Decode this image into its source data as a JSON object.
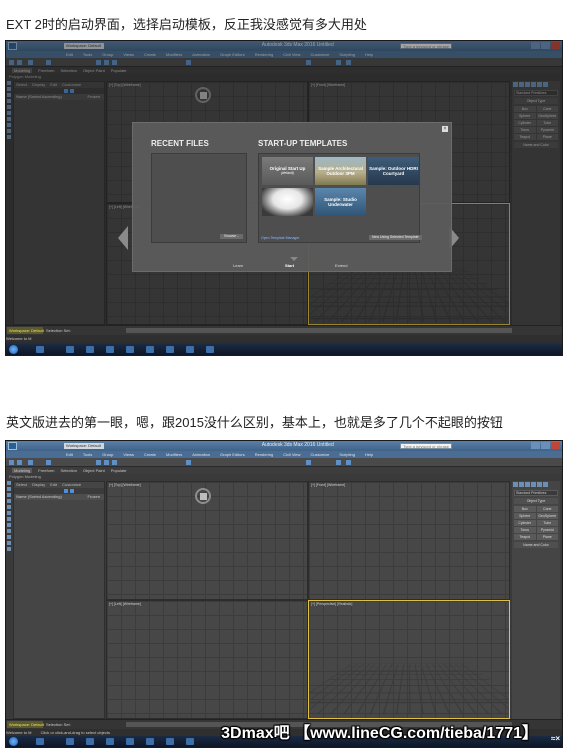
{
  "captions": {
    "top": "EXT 2时的启动界面，选择启动模板，反正我没感觉有多大用处",
    "bottom": "英文版进去的第一眼，嗯，跟2015没什么区别，基本上，也就是多了几个不起眼的按钮"
  },
  "app": {
    "window_title": "Autodesk 3ds Max 2016   Untitled",
    "workspace_label": "Workspace: Default",
    "search_placeholder": "Type a keyword or phrase",
    "menus": [
      "Edit",
      "Tools",
      "Group",
      "Views",
      "Create",
      "Modifiers",
      "Animation",
      "Graph Editors",
      "Rendering",
      "Civil View",
      "Customize",
      "Scripting",
      "Help"
    ],
    "ribbon_tabs": [
      "Modeling",
      "Freeform",
      "Selection",
      "Object Paint",
      "Populate"
    ],
    "ribbon_sub": "Polygon Modeling",
    "explorer": {
      "tabs": [
        "Select",
        "Display",
        "Edit",
        "Customize"
      ],
      "header_name": "Name (Sorted Ascending)",
      "header_frozen": "Frozen"
    },
    "viewports": {
      "top": "[+] [Top] [Wireframe]",
      "front": "[+] [Front] [Wireframe]",
      "left": "[+] [Left] [Wireframe]",
      "perspective": "[+] [Perspective] [Realistic]"
    },
    "cmd_panel": {
      "dropdown": "Standard Primitives",
      "rollout_object": "Object Type",
      "autogrid": "AutoGrid",
      "buttons": [
        "Box",
        "Cone",
        "Sphere",
        "GeoSphere",
        "Cylinder",
        "Tube",
        "Torus",
        "Pyramid",
        "Teapot",
        "Plane"
      ],
      "rollout_name": "Name and Color"
    },
    "status": {
      "workspace": "Workspace: Default",
      "selection_set": "Selection Set:",
      "welcome": "Welcome to M",
      "hint": "Click or click-and-drag to select objects",
      "none_selected": "None Selected"
    },
    "startup_dialog": {
      "recent_title": "RECENT FILES",
      "templates_title": "START-UP TEMPLATES",
      "browse": "Browse...",
      "templates": [
        {
          "name": "Original Start Up",
          "sub": "(default)"
        },
        {
          "name": "Sample Architectural Outdoor 3PM",
          "sub": ""
        },
        {
          "name": "Sample: Outdoor HDRI Courtyard",
          "sub": ""
        },
        {
          "name": "",
          "sub": ""
        },
        {
          "name": "Sample: Studio Underwater",
          "sub": ""
        }
      ],
      "learn_link": "Open Template Manager",
      "new_empty": "New Using Selected Template",
      "nav": [
        "Learn",
        "Start",
        "Extend"
      ]
    }
  },
  "watermark": "3Dmax吧 【www.lineCG.com/tieba/1771】",
  "watermark_small": "≈×",
  "colors": {
    "viewport_bg": "#474747",
    "active_border": "#e0c040",
    "workspace_btn": "#f0e070"
  }
}
